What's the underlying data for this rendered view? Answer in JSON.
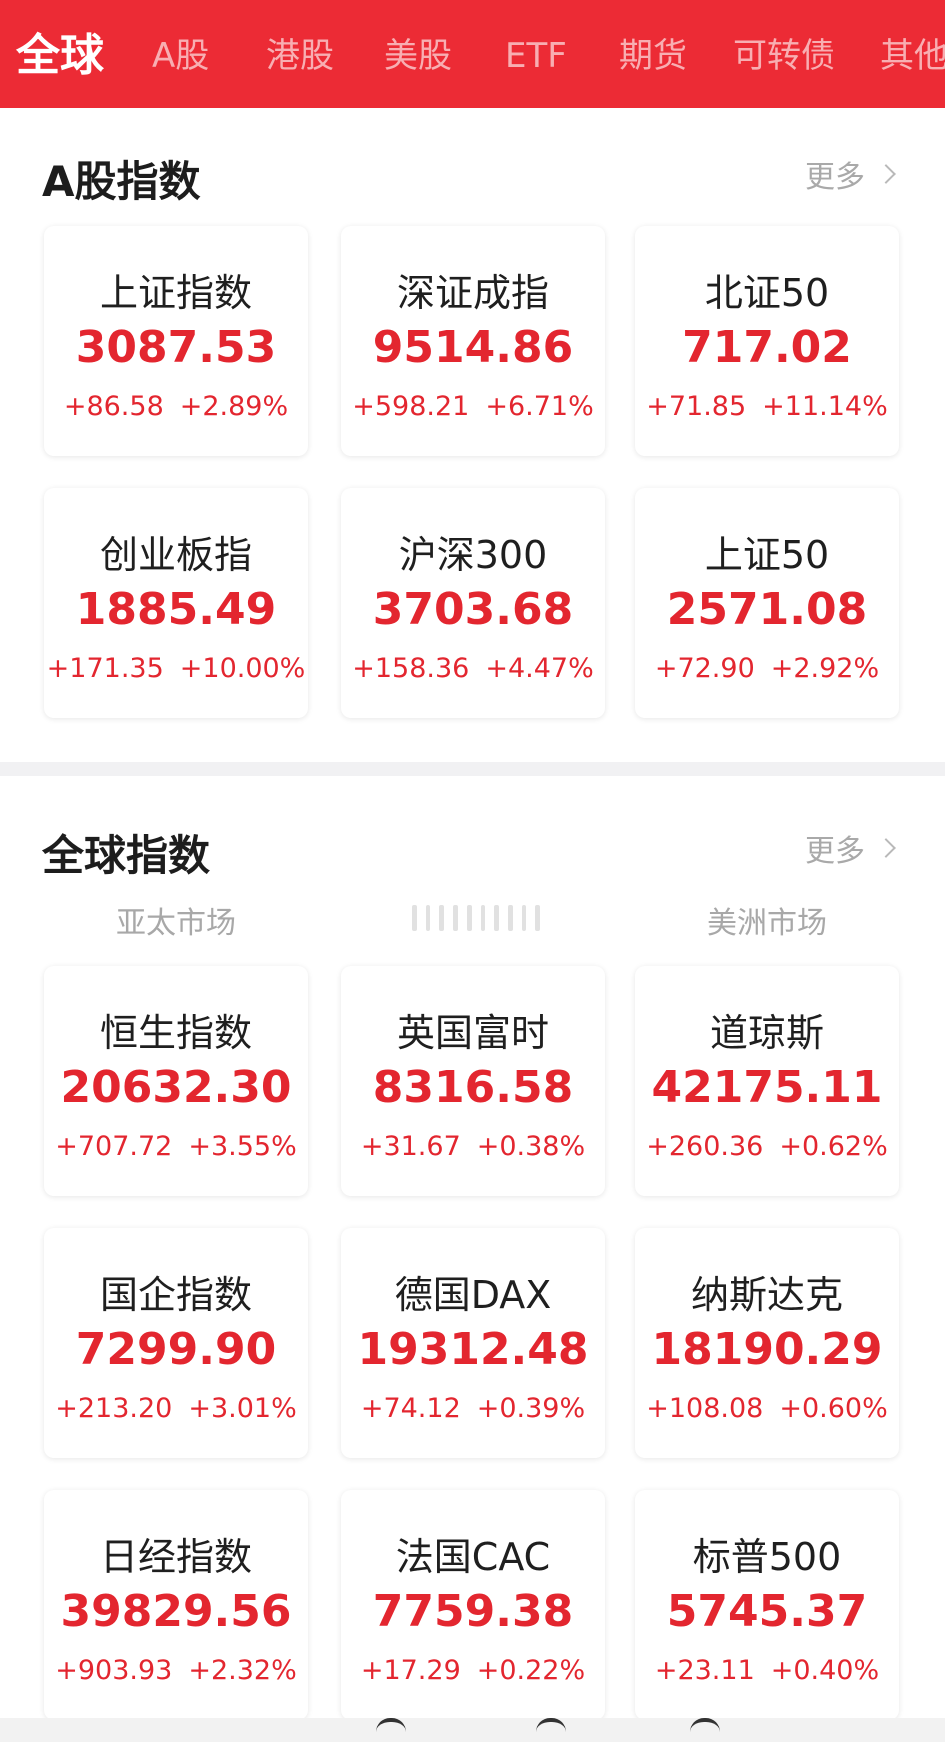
{
  "tabs": [
    {
      "label": "全球",
      "active": true
    },
    {
      "label": "A股"
    },
    {
      "label": "港股"
    },
    {
      "label": "美股"
    },
    {
      "label": "ETF"
    },
    {
      "label": "期货"
    },
    {
      "label": "可转债"
    },
    {
      "label": "其他"
    }
  ],
  "a_share": {
    "title": "A股指数",
    "more": "更多",
    "cards": [
      {
        "name": "上证指数",
        "price": "3087.53",
        "change": "+86.58",
        "pct": "+2.89%"
      },
      {
        "name": "深证成指",
        "price": "9514.86",
        "change": "+598.21",
        "pct": "+6.71%"
      },
      {
        "name": "北证50",
        "price": "717.02",
        "change": "+71.85",
        "pct": "+11.14%"
      },
      {
        "name": "创业板指",
        "price": "1885.49",
        "change": "+171.35",
        "pct": "+10.00%"
      },
      {
        "name": "沪深300",
        "price": "3703.68",
        "change": "+158.36",
        "pct": "+4.47%"
      },
      {
        "name": "上证50",
        "price": "2571.08",
        "change": "+72.90",
        "pct": "+2.92%"
      }
    ]
  },
  "global": {
    "title": "全球指数",
    "more": "更多",
    "markets": {
      "left": "亚太市场",
      "right": "美洲市场"
    },
    "cards": [
      {
        "name": "恒生指数",
        "price": "20632.30",
        "change": "+707.72",
        "pct": "+3.55%"
      },
      {
        "name": "英国富时",
        "price": "8316.58",
        "change": "+31.67",
        "pct": "+0.38%"
      },
      {
        "name": "道琼斯",
        "price": "42175.11",
        "change": "+260.36",
        "pct": "+0.62%"
      },
      {
        "name": "国企指数",
        "price": "7299.90",
        "change": "+213.20",
        "pct": "+3.01%"
      },
      {
        "name": "德国DAX",
        "price": "19312.48",
        "change": "+74.12",
        "pct": "+0.39%"
      },
      {
        "name": "纳斯达克",
        "price": "18190.29",
        "change": "+108.08",
        "pct": "+0.60%"
      },
      {
        "name": "日经指数",
        "price": "39829.56",
        "change": "+903.93",
        "pct": "+2.32%"
      },
      {
        "name": "法国CAC",
        "price": "7759.38",
        "change": "+17.29",
        "pct": "+0.22%"
      },
      {
        "name": "标普500",
        "price": "5745.37",
        "change": "+23.11",
        "pct": "+0.40%"
      }
    ]
  },
  "colors": {
    "brand": "#ec2b35",
    "up": "#e3262f"
  }
}
